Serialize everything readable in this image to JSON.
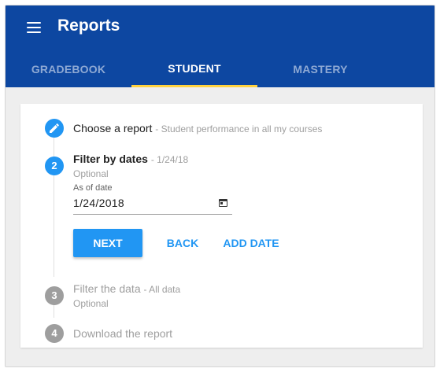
{
  "header": {
    "title": "Reports",
    "tabs": [
      {
        "label": "GRADEBOOK",
        "active": false
      },
      {
        "label": "STUDENT",
        "active": true
      },
      {
        "label": "MASTERY",
        "active": false
      }
    ]
  },
  "stepper": {
    "steps": [
      {
        "number": "",
        "icon": "pencil-icon",
        "title": "Choose a report",
        "summary": "- Student performance in all my courses",
        "state": "completed"
      },
      {
        "number": "2",
        "title": "Filter by dates",
        "summary": "- 1/24/18",
        "optional": "Optional",
        "state": "active"
      },
      {
        "number": "3",
        "title": "Filter the data",
        "summary": "- All data",
        "optional": "Optional",
        "state": "inactive"
      },
      {
        "number": "4",
        "title": "Download the report",
        "state": "inactive"
      }
    ],
    "date_field": {
      "label": "As of date",
      "value": "1/24/2018",
      "icon": "calendar-icon"
    },
    "actions": {
      "next": "NEXT",
      "back": "BACK",
      "add_date": "ADD DATE"
    }
  },
  "colors": {
    "appbar": "#0d47a1",
    "accent": "#2196f3",
    "tab_indicator": "#ffd23f",
    "inactive_step": "#9e9e9e"
  }
}
